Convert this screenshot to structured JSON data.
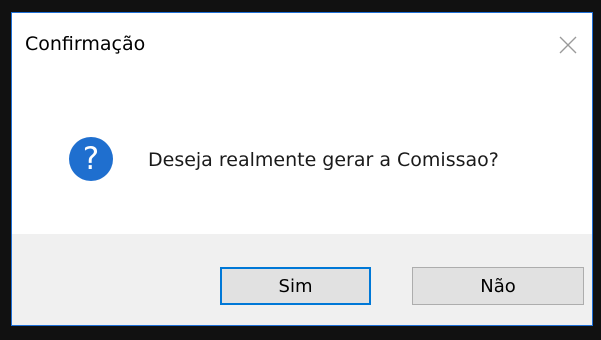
{
  "dialog": {
    "title": "Confirmação",
    "close_icon": "close-icon",
    "message_icon": "question-icon",
    "icon_glyph": "?",
    "message": "Deseja realmente gerar a Comissao?",
    "buttons": {
      "yes_label": "Sim",
      "no_label": "Não"
    },
    "accent_color": "#0078d7",
    "icon_color": "#1f6fcf"
  }
}
